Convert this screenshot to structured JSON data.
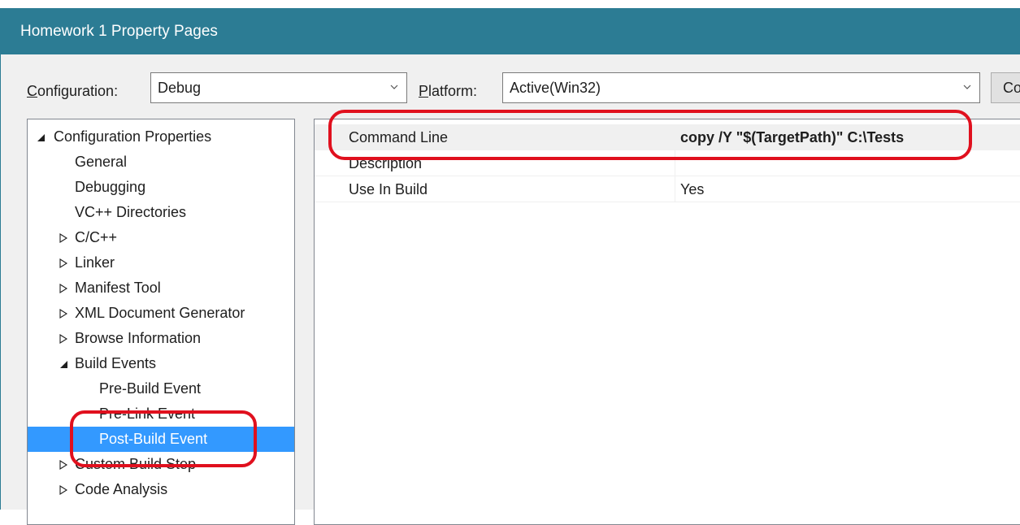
{
  "window": {
    "title": "Homework 1 Property Pages"
  },
  "toolbar": {
    "configuration_label_u": "C",
    "configuration_label_rest": "onfiguration:",
    "configuration_value": "Debug",
    "platform_label_u": "P",
    "platform_label_rest": "latform:",
    "platform_value": "Active(Win32)",
    "config_manager_label": "Co"
  },
  "tree": {
    "items": [
      {
        "label": "Configuration Properties",
        "expander": "expanded"
      },
      {
        "label": "General",
        "expander": "none"
      },
      {
        "label": "Debugging",
        "expander": "none"
      },
      {
        "label": "VC++ Directories",
        "expander": "none"
      },
      {
        "label": "C/C++",
        "expander": "collapsed"
      },
      {
        "label": "Linker",
        "expander": "collapsed"
      },
      {
        "label": "Manifest Tool",
        "expander": "collapsed"
      },
      {
        "label": "XML Document Generator",
        "expander": "collapsed"
      },
      {
        "label": "Browse Information",
        "expander": "collapsed"
      },
      {
        "label": "Build Events",
        "expander": "expanded"
      },
      {
        "label": "Pre-Build Event",
        "expander": "none"
      },
      {
        "label": "Pre-Link Event",
        "expander": "none"
      },
      {
        "label": "Post-Build Event",
        "expander": "none",
        "selected": true
      },
      {
        "label": "Custom Build Step",
        "expander": "collapsed"
      },
      {
        "label": "Code Analysis",
        "expander": "collapsed"
      }
    ]
  },
  "properties": {
    "rows": [
      {
        "name": "Command Line",
        "value": "copy /Y \"$(TargetPath)\" C:\\Tests"
      },
      {
        "name": "Description",
        "value": ""
      },
      {
        "name": "Use In Build",
        "value": "Yes"
      }
    ]
  },
  "colors": {
    "titlebar": "#2c7c94",
    "selection": "#3399ff",
    "highlight_marker": "#e0101e"
  }
}
